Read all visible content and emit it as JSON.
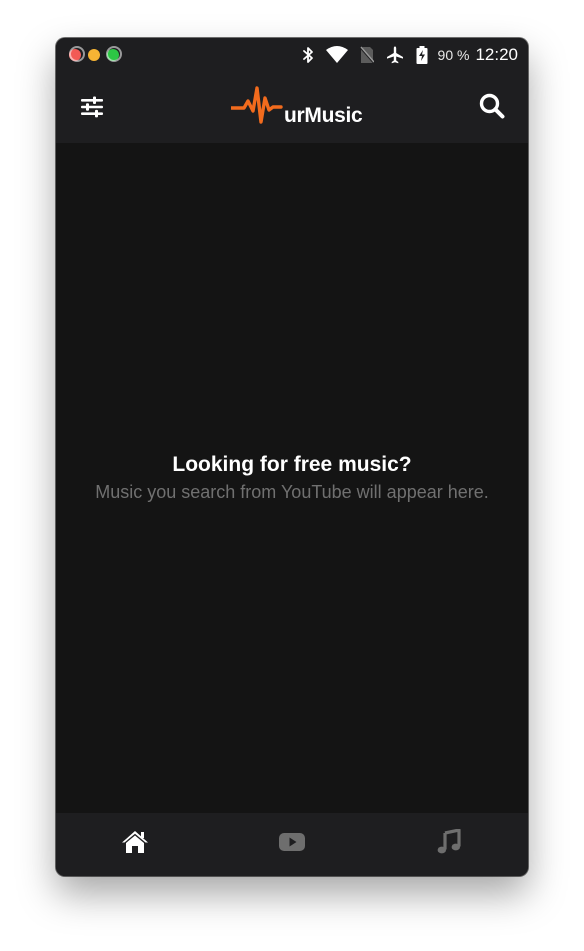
{
  "app": {
    "name": "urMusic"
  },
  "status_bar": {
    "battery_percent": "90 %",
    "time": "12:20"
  },
  "toolbar": {
    "logo_text": "urMusic",
    "filter_icon": "sliders-icon",
    "search_icon": "search-icon"
  },
  "empty_state": {
    "title": "Looking for free music?",
    "subtitle": "Music you search from YouTube will appear here."
  },
  "bottom_nav": {
    "items": [
      {
        "icon": "home-icon",
        "active": true
      },
      {
        "icon": "youtube-icon",
        "active": false
      },
      {
        "icon": "music-note-icon",
        "active": false
      }
    ]
  },
  "colors": {
    "brand_orange": "#f26b1d",
    "background": "#141414",
    "bar": "#1e1e20",
    "active_icon": "#ffffff",
    "inactive_icon": "#6e6e6e"
  }
}
